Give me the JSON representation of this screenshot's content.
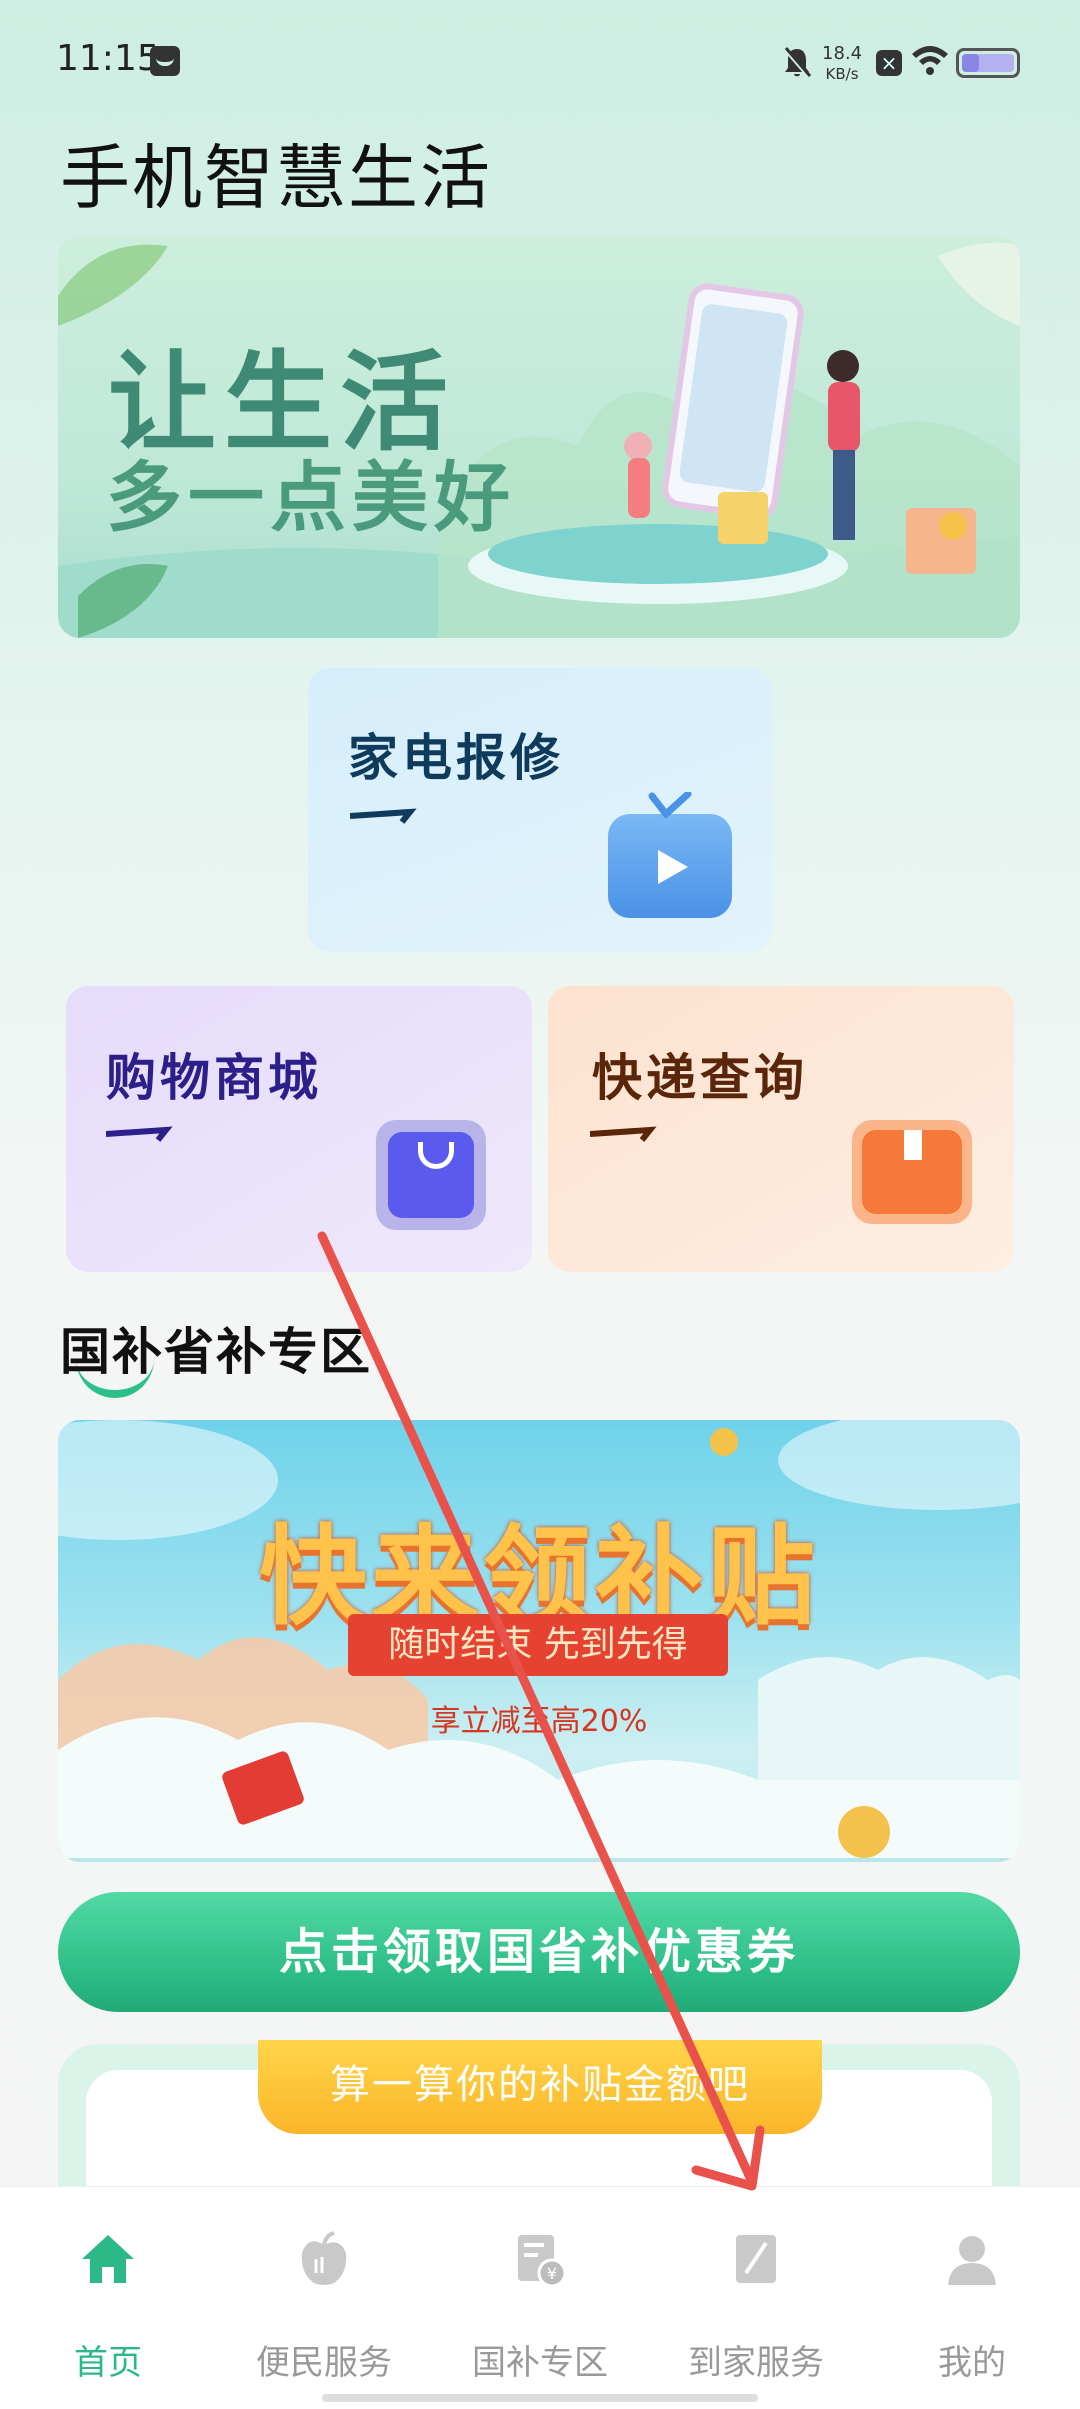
{
  "status_bar": {
    "time": "11:15",
    "net_speed_value": "18.4",
    "net_speed_unit": "KB/s",
    "battery_level": 0.3
  },
  "page": {
    "title": "手机智慧生活"
  },
  "hero_banner": {
    "line1": "让生活",
    "line2": "多一点美好"
  },
  "service_cards": {
    "repair": {
      "title": "家电报修",
      "color": "#0e3b5c"
    },
    "shop": {
      "title": "购物商城",
      "color": "#2c1f8a"
    },
    "express": {
      "title": "快递查询",
      "color": "#5a2508"
    }
  },
  "subsidy_section": {
    "title": "国补省补专区",
    "banner_headline": "快来领补贴",
    "banner_ribbon": "随时结束 先到先得",
    "banner_note": "享立减至高20%",
    "coupon_button": "点击领取国省补优惠券",
    "calc_banner": "算一算你的补贴金额吧"
  },
  "bottom_nav": {
    "items": [
      {
        "label": "首页",
        "icon": "home-icon",
        "active": true
      },
      {
        "label": "便民服务",
        "icon": "apple-icon",
        "active": false
      },
      {
        "label": "国补专区",
        "icon": "coin-doc-icon",
        "active": false
      },
      {
        "label": "到家服务",
        "icon": "note-icon",
        "active": false
      },
      {
        "label": "我的",
        "icon": "person-icon",
        "active": false
      }
    ]
  },
  "colors": {
    "accent": "#2db888",
    "nav_inactive": "#999999",
    "overlay_arrow": "#e8524a"
  }
}
